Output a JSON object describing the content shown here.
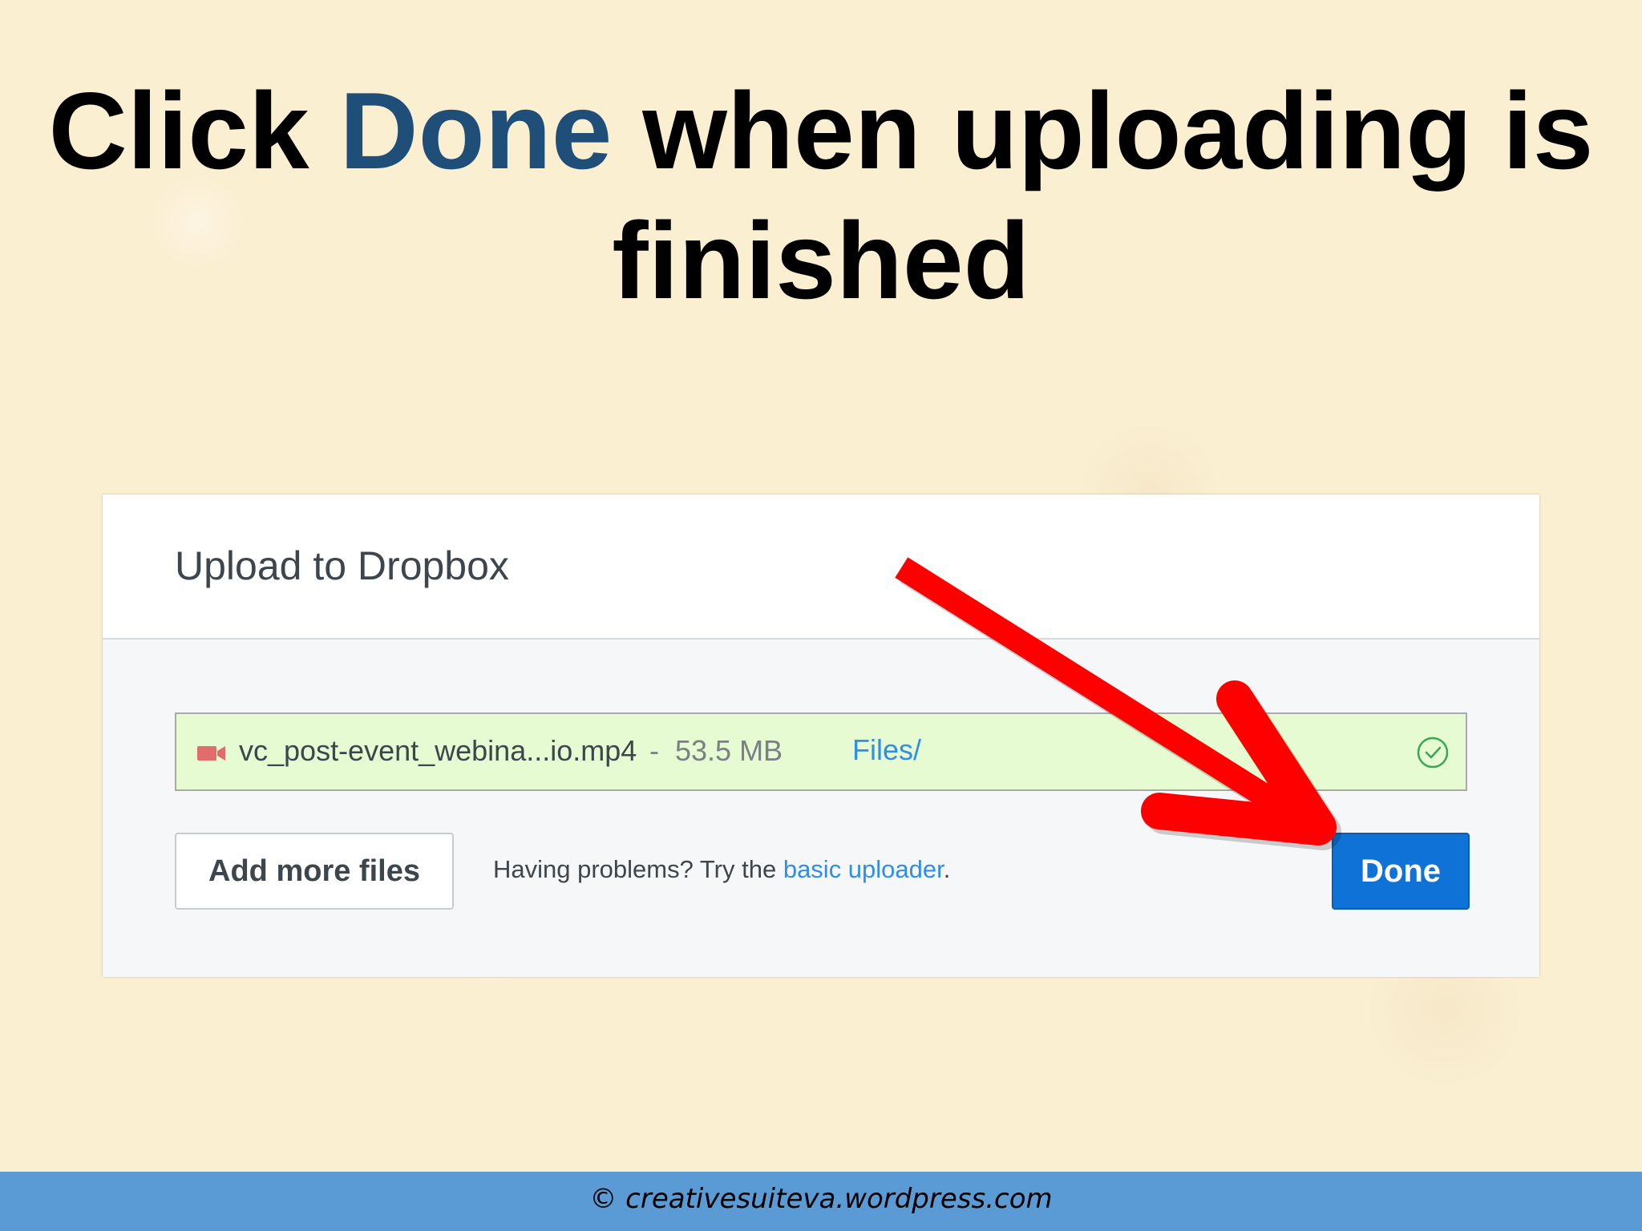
{
  "slide": {
    "title_pre": "Click ",
    "title_accent": "Done",
    "title_post": " when uploading is finished",
    "accent_color": "#1f4e79"
  },
  "dialog": {
    "title": "Upload to Dropbox",
    "file": {
      "icon": "video-file-icon",
      "name": "vc_post-event_webina...io.mp4",
      "separator": "-",
      "size": "53.5 MB",
      "destination": "Files/",
      "status_icon": "check-circle-icon",
      "status_color": "#3aa655",
      "row_color": "#e6fbd2"
    },
    "add_more_label": "Add more files",
    "help_prefix": "Having problems? Try the ",
    "help_link": "basic uploader",
    "help_suffix": ".",
    "done_label": "Done",
    "done_color": "#0f72d6",
    "link_color": "#2f8ee8"
  },
  "annotation": {
    "arrow_icon": "red-pointer-arrow",
    "arrow_color": "#ff0000"
  },
  "footer": {
    "text": "© creativesuiteva.wordpress.com",
    "color": "#5b9bd5"
  }
}
